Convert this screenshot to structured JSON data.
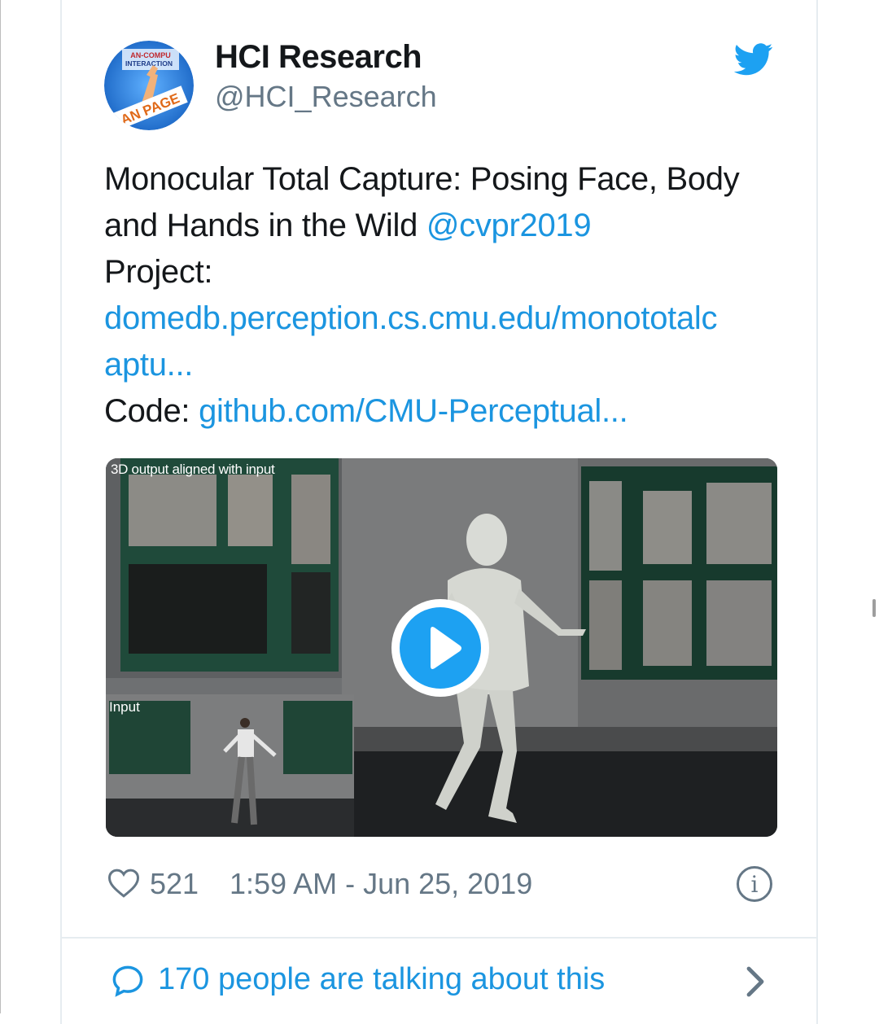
{
  "author": {
    "name": "HCI Research",
    "handle": "@HCI_Research",
    "avatar_text": "HUMAN-COMPUTER INTERACTION · FAN PAGE"
  },
  "tweet": {
    "line1": "Monocular Total Capture: Posing Face, Body",
    "line2_text": "and Hands in the Wild ",
    "mention": "@cvpr2019",
    "project_label": "Project:",
    "project_link_1": "domedb.perception.cs.cmu.edu/monototalc",
    "project_link_2": "aptu...",
    "code_label": "Code: ",
    "code_link": "github.com/CMU-Perceptual..."
  },
  "media": {
    "caption": "3D output aligned with input",
    "inset_caption": "Input"
  },
  "footer": {
    "like_count": "521",
    "timestamp": "1:59 AM - Jun 25, 2019"
  },
  "conversation": {
    "label": "170 people are talking about this"
  },
  "colors": {
    "link": "#1b95e0",
    "twitter_blue": "#1da1f2",
    "secondary_text": "#657786",
    "primary_text": "#14171a"
  },
  "icons": [
    "twitter-bird-icon",
    "heart-icon",
    "info-icon",
    "speech-bubble-icon",
    "chevron-right-icon",
    "play-icon"
  ]
}
